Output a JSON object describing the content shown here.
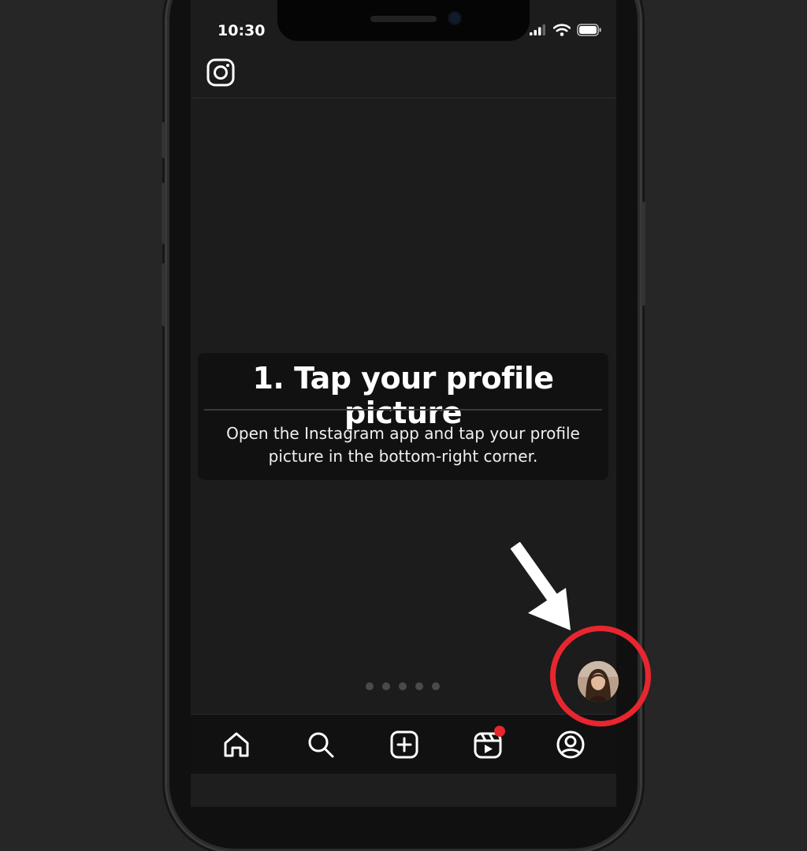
{
  "status_bar": {
    "time": "10:30"
  },
  "header": {
    "logo_icon": "instagram-logo-icon"
  },
  "instruction_card": {
    "title": "1. Tap your profile picture",
    "body": "Open the Instagram app and tap your profile picture in the bottom-right corner."
  },
  "pagination": {
    "total_dots": 5
  },
  "bottom_nav": {
    "items": [
      {
        "icon": "home-icon"
      },
      {
        "icon": "search-icon"
      },
      {
        "icon": "add-post-icon"
      },
      {
        "icon": "reels-icon",
        "notification_dot": true
      },
      {
        "icon": "profile-icon"
      }
    ]
  },
  "callout": {
    "ring_color": "#e8262f",
    "arrow_color": "#ffffff",
    "target": "profile-picture-avatar"
  },
  "colors": {
    "background": "#262626",
    "screen": "#1c1c1c",
    "accent_red": "#e8262f"
  }
}
